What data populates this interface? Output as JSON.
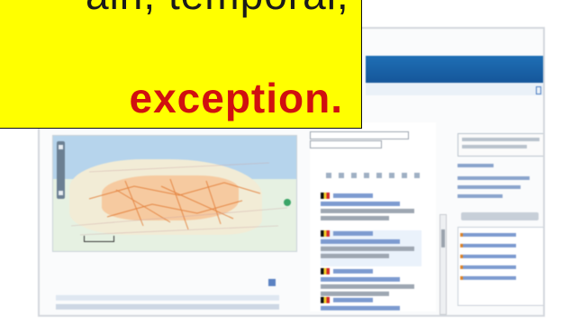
{
  "callout": {
    "top_text": "ain, temporal,",
    "main_text": "exception."
  },
  "webapp": {
    "header_link": "",
    "tabs": [
      "",
      "",
      ""
    ],
    "results_summary": "",
    "activity_title": "",
    "activity_subtitle": ""
  },
  "colors": {
    "callout_bg": "#ffff00",
    "callout_text": "#d01010",
    "header_blue": "#1f6fb5"
  }
}
